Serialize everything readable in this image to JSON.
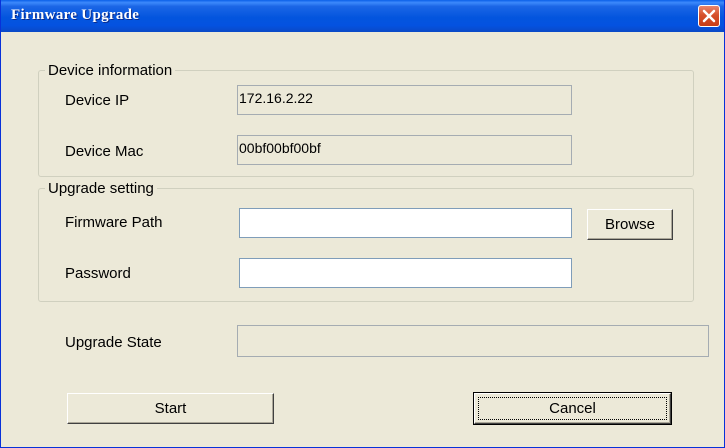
{
  "window": {
    "title": "Firmware Upgrade"
  },
  "icons": {
    "close": "close-icon"
  },
  "device_info": {
    "legend": "Device information",
    "ip_label": "Device IP",
    "ip_value": "172.16.2.22",
    "mac_label": "Device Mac",
    "mac_value": "00bf00bf00bf"
  },
  "upgrade_setting": {
    "legend": "Upgrade setting",
    "path_label": "Firmware Path",
    "path_value": "",
    "browse_label": "Browse",
    "password_label": "Password",
    "password_value": ""
  },
  "state": {
    "label": "Upgrade State",
    "value": ""
  },
  "actions": {
    "start_label": "Start",
    "cancel_label": "Cancel"
  }
}
